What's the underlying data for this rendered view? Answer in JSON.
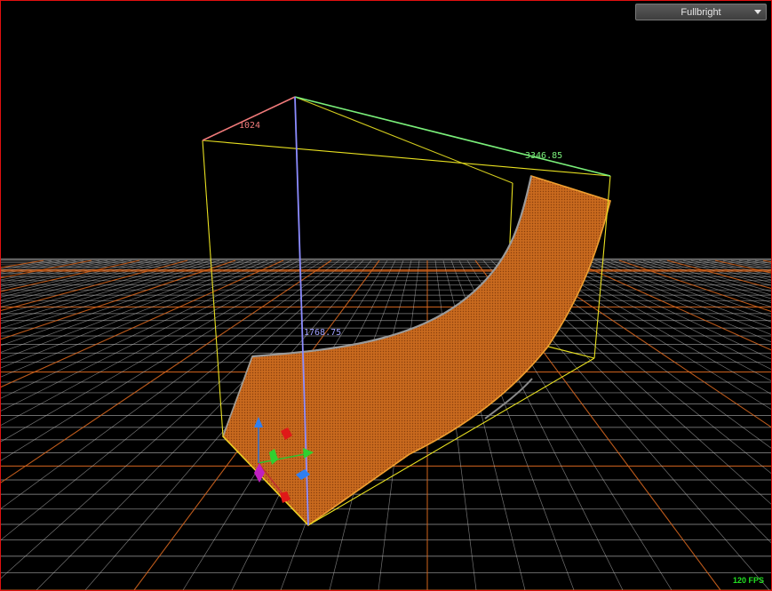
{
  "viewport": {
    "view_mode": "Fullbright",
    "fps": "120 FPS",
    "dimensions": {
      "depth": "1024",
      "width": "3346.85",
      "height": "1768.75"
    },
    "colors": {
      "mesh_fill": "#c8691e",
      "mesh_edge": "#f0a030",
      "bounding_box": "#e8e020",
      "grid_minor": "#bdbdbd",
      "grid_major": "#d2641e",
      "axis_x": "#f07a7a",
      "axis_y": "#7af07a",
      "axis_z": "#8c8cff",
      "border": "#e01010"
    }
  }
}
